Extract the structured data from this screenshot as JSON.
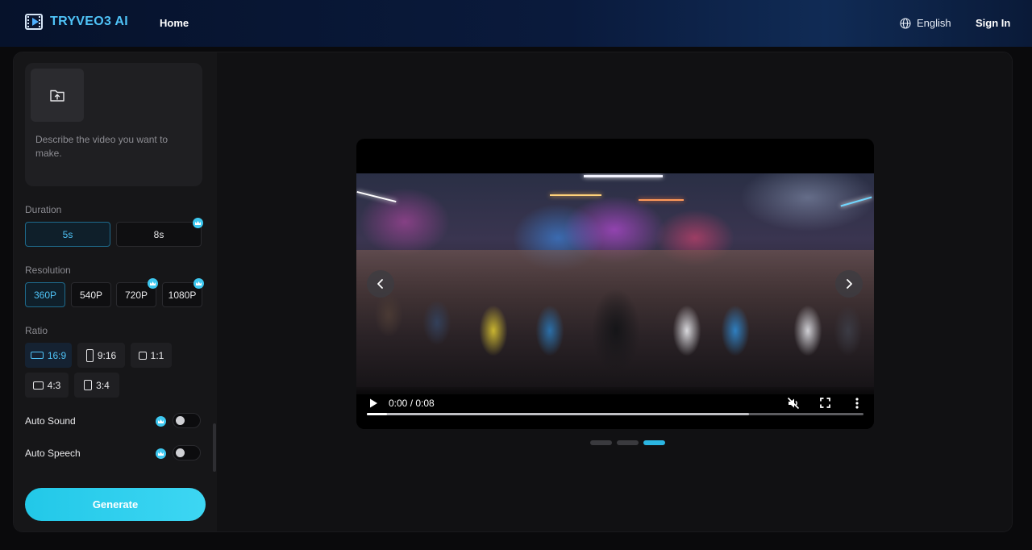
{
  "header": {
    "brand": "TRYVEO3 AI",
    "nav": [
      "Home"
    ],
    "language": "English",
    "sign_in": "Sign In"
  },
  "sidebar": {
    "prompt_placeholder": "Describe the video you want to make.",
    "duration": {
      "label": "Duration",
      "options": [
        "5s",
        "8s"
      ],
      "selected": "5s",
      "premium": [
        "8s"
      ]
    },
    "resolution": {
      "label": "Resolution",
      "options": [
        "360P",
        "540P",
        "720P",
        "1080P"
      ],
      "selected": "360P",
      "premium": [
        "720P",
        "1080P"
      ]
    },
    "ratio": {
      "label": "Ratio",
      "options": [
        "16:9",
        "9:16",
        "1:1",
        "4:3",
        "3:4"
      ],
      "selected": "16:9"
    },
    "toggles": [
      {
        "label": "Auto Sound",
        "on": false,
        "premium": true
      },
      {
        "label": "Auto Speech",
        "on": false,
        "premium": true
      }
    ],
    "generate_label": "Generate"
  },
  "player": {
    "time": "0:00 / 0:08",
    "muted": true,
    "played_fraction": 0.04,
    "buffered_fraction": 0.77
  },
  "carousel": {
    "count": 3,
    "active_index": 2
  },
  "colors": {
    "accent": "#2bb6e2",
    "brand_text": "#4fc3f7",
    "generate_start": "#22c8e8",
    "generate_end": "#3dd6f3"
  },
  "icons": {
    "upload": "folder-upload-icon",
    "language": "globe-icon",
    "premium": "crown-icon",
    "prev": "chevron-left-icon",
    "next": "chevron-right-icon",
    "play": "play-icon",
    "mute": "volume-muted-icon",
    "fullscreen": "fullscreen-icon",
    "more": "more-vertical-icon"
  }
}
